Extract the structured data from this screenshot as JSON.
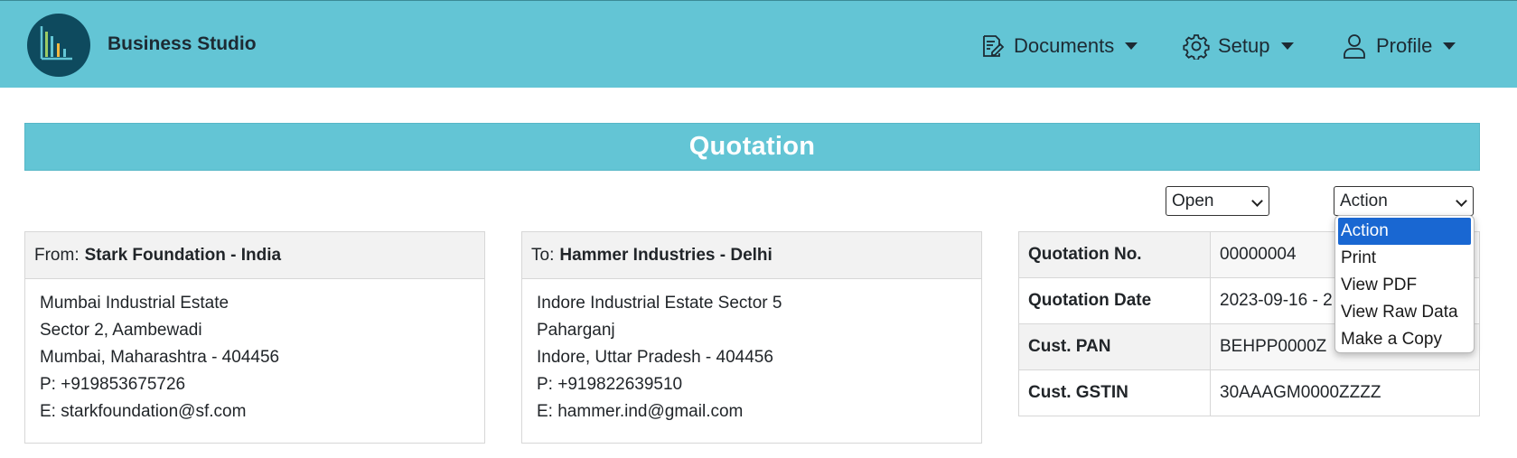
{
  "app": {
    "brand": "Business Studio"
  },
  "nav": {
    "documents": {
      "label": "Documents",
      "icon": "document-edit-icon"
    },
    "setup": {
      "label": "Setup",
      "icon": "gear-icon"
    },
    "profile": {
      "label": "Profile",
      "icon": "user-icon"
    }
  },
  "page": {
    "title": "Quotation"
  },
  "controls": {
    "status": {
      "value": "Open"
    },
    "action": {
      "value": "Action",
      "options": [
        "Action",
        "Print",
        "View PDF",
        "View Raw Data",
        "Make a Copy"
      ]
    }
  },
  "from": {
    "prefix": "From:",
    "name": "Stark Foundation - India",
    "lines": [
      "Mumbai Industrial Estate",
      "Sector 2, Aambewadi",
      "Mumbai, Maharashtra - 404456",
      "P: +919853675726",
      "E: starkfoundation@sf.com"
    ]
  },
  "to": {
    "prefix": "To:",
    "name": "Hammer Industries - Delhi",
    "lines": [
      "Indore Industrial Estate Sector 5",
      "Paharganj",
      "Indore, Uttar Pradesh - 404456",
      "P: +919822639510",
      "E: hammer.ind@gmail.com"
    ]
  },
  "details": [
    {
      "label": "Quotation No.",
      "value": "00000004"
    },
    {
      "label": "Quotation Date",
      "value": "2023-09-16 - 2"
    },
    {
      "label": "Cust. PAN",
      "value": "BEHPP0000Z"
    },
    {
      "label": "Cust. GSTIN",
      "value": "30AAAGM0000ZZZZ"
    }
  ],
  "colors": {
    "header": "#63c5d5",
    "logo_bg": "#0e4a5e",
    "selected_option": "#1967d2"
  }
}
